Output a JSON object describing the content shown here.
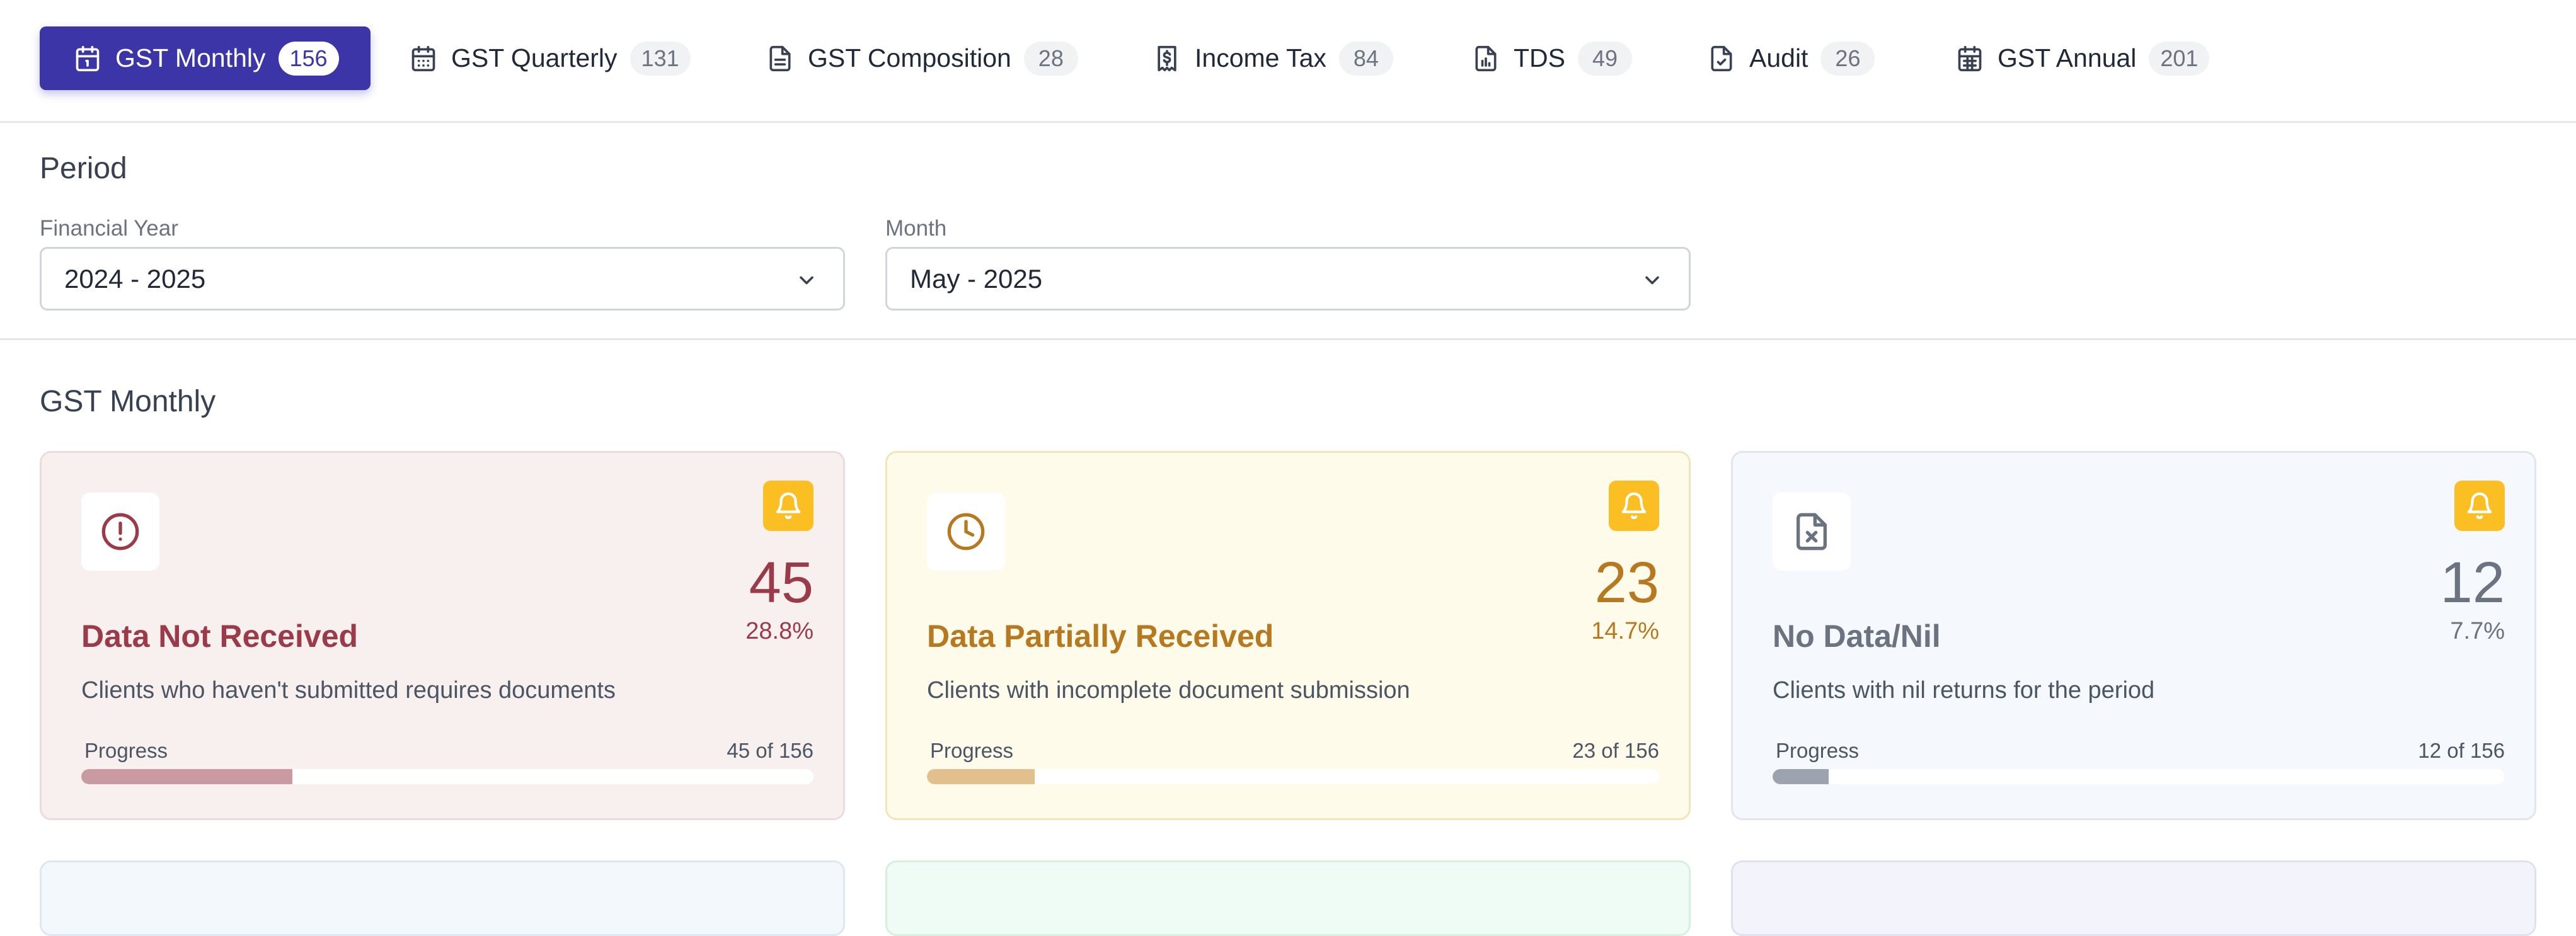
{
  "tabs": [
    {
      "label": "GST Monthly",
      "count": "156",
      "icon": "calendar-icon",
      "active": true
    },
    {
      "label": "GST Quarterly",
      "count": "131",
      "icon": "calendar-icon"
    },
    {
      "label": "GST Composition",
      "count": "28",
      "icon": "document-icon"
    },
    {
      "label": "Income Tax",
      "count": "84",
      "icon": "receipt-icon"
    },
    {
      "label": "TDS",
      "count": "49",
      "icon": "file-chart-icon"
    },
    {
      "label": "Audit",
      "count": "26",
      "icon": "file-check-icon"
    },
    {
      "label": "GST Annual",
      "count": "201",
      "icon": "calendar-icon"
    }
  ],
  "period": {
    "title": "Period",
    "financial_year": {
      "label": "Financial Year",
      "value": "2024 - 2025"
    },
    "month": {
      "label": "Month",
      "value": "May - 2025"
    }
  },
  "section": {
    "title": "GST Monthly"
  },
  "cards": [
    {
      "title": "Data Not Received",
      "count": "45",
      "percent": "28.8%",
      "description": "Clients who haven't submitted requires documents",
      "progress_label": "Progress",
      "progress_text": "45 of 156",
      "progress_fraction": 0.288,
      "icon": "alert-circle-icon"
    },
    {
      "title": "Data Partially Received",
      "count": "23",
      "percent": "14.7%",
      "description": "Clients with incomplete document submission",
      "progress_label": "Progress",
      "progress_text": "23 of 156",
      "progress_fraction": 0.147,
      "icon": "clock-icon"
    },
    {
      "title": "No Data/Nil",
      "count": "12",
      "percent": "7.7%",
      "description": "Clients with nil returns for the period",
      "progress_label": "Progress",
      "progress_text": "12 of 156",
      "progress_fraction": 0.077,
      "icon": "file-x-icon"
    }
  ],
  "colors": {
    "primary": "#3b35a8",
    "bell": "#fbbf24",
    "not_received": "#9b3b4a",
    "partial": "#b7791f",
    "nil": "#6b7280"
  }
}
